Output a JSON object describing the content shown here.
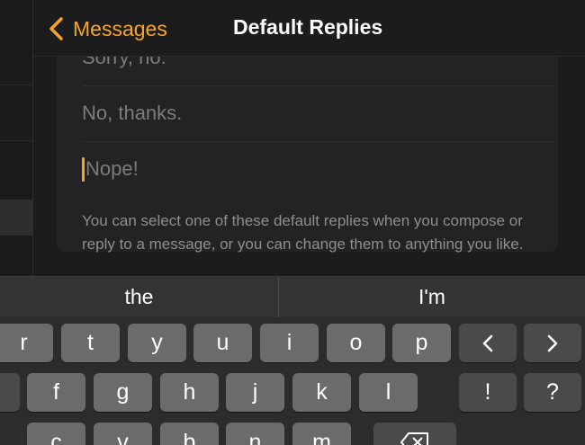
{
  "nav": {
    "back_label": "Messages",
    "title": "Default Replies"
  },
  "replies": [
    {
      "text": "Sorry, no."
    },
    {
      "text": "No, thanks."
    },
    {
      "text": "Nope!"
    }
  ],
  "footer_note": "You can select one of these default replies when you compose or reply to a message, or you can change them to anything you like.",
  "keyboard": {
    "predictions": [
      "the",
      "I'm"
    ],
    "row1": [
      "r",
      "t",
      "y",
      "u",
      "i",
      "o",
      "p"
    ],
    "row2": [
      "f",
      "g",
      "h",
      "j",
      "k",
      "l"
    ],
    "row3": [
      "c",
      "v",
      "b",
      "n",
      "m"
    ],
    "punct1": "!",
    "punct2": "?",
    "icons": {
      "left": "chevron-left-icon",
      "right": "chevron-right-icon",
      "delete": "delete-icon"
    }
  },
  "colors": {
    "accent": "#f5a623",
    "background": "#1c1c1e",
    "key": "#6b6b6e",
    "key_dark": "#4a4a4c"
  }
}
